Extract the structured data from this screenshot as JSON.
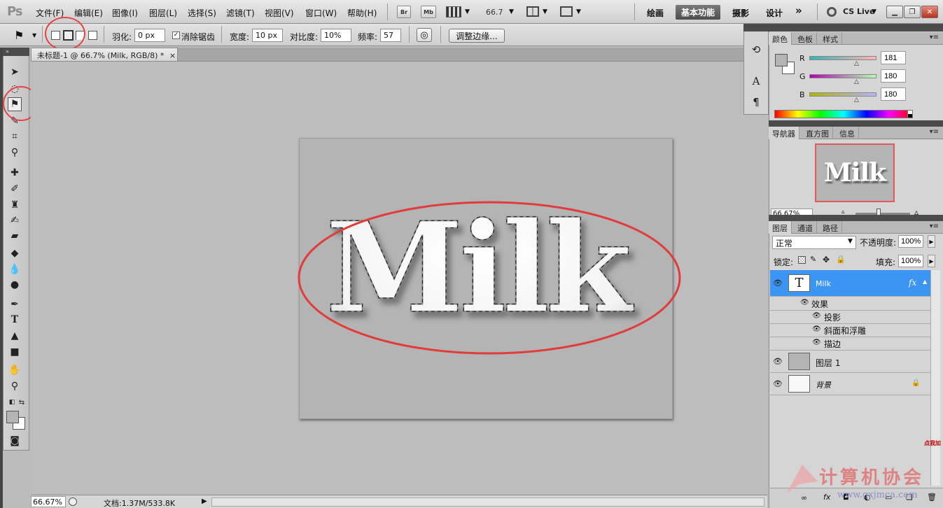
{
  "app": {
    "logo": "Ps"
  },
  "menu": {
    "items": [
      "文件(F)",
      "编辑(E)",
      "图像(I)",
      "图层(L)",
      "选择(S)",
      "滤镜(T)",
      "视图(V)",
      "窗口(W)",
      "帮助(H)"
    ],
    "bridge_label": "Br",
    "minibridge_label": "Mb",
    "zoom": "66.7",
    "workspaces": [
      "绘画",
      "基本功能",
      "摄影",
      "设计"
    ],
    "more": "»",
    "cslive": "CS Live"
  },
  "options": {
    "feather_label": "羽化:",
    "feather_value": "0 px",
    "antialias_label": "消除锯齿",
    "antialias_checked": "✓",
    "width_label": "宽度:",
    "width_value": "10 px",
    "contrast_label": "对比度:",
    "contrast_value": "10%",
    "frequency_label": "频率:",
    "frequency_value": "57",
    "refine_edge": "调整边缘..."
  },
  "document": {
    "tab_title": "未标题-1 @ 66.7% (Milk, RGB/8) *",
    "tab_close": "×",
    "canvas_text": "Milk",
    "status_zoom": "66.67%",
    "status_doc": "文档:1.37M/533.8K"
  },
  "color_panel": {
    "tabs": [
      "颜色",
      "色板",
      "样式"
    ],
    "r_label": "R",
    "r_value": "181",
    "g_label": "G",
    "g_value": "180",
    "b_label": "B",
    "b_value": "180",
    "foreground": "#b5b4b4"
  },
  "navigator_panel": {
    "tabs": [
      "导航器",
      "直方图",
      "信息"
    ],
    "preview_text": "Milk",
    "zoom": "66.67%"
  },
  "layers_panel": {
    "tabs": [
      "图层",
      "通道",
      "路径"
    ],
    "blend_mode": "正常",
    "opacity_label": "不透明度:",
    "opacity_value": "100%",
    "lock_label": "锁定:",
    "fill_label": "填充:",
    "fill_value": "100%",
    "text_layer_name": "Milk",
    "text_layer_thumb": "T",
    "fx_mark": "fx",
    "effects_label": "效果",
    "effects": [
      "投影",
      "斜面和浮雕",
      "描边"
    ],
    "layer1_name": "图层 1",
    "background_name": "背景"
  },
  "watermark": {
    "title": "计算机协会",
    "url": "www.gxjmca.com",
    "badge": "点我加"
  }
}
